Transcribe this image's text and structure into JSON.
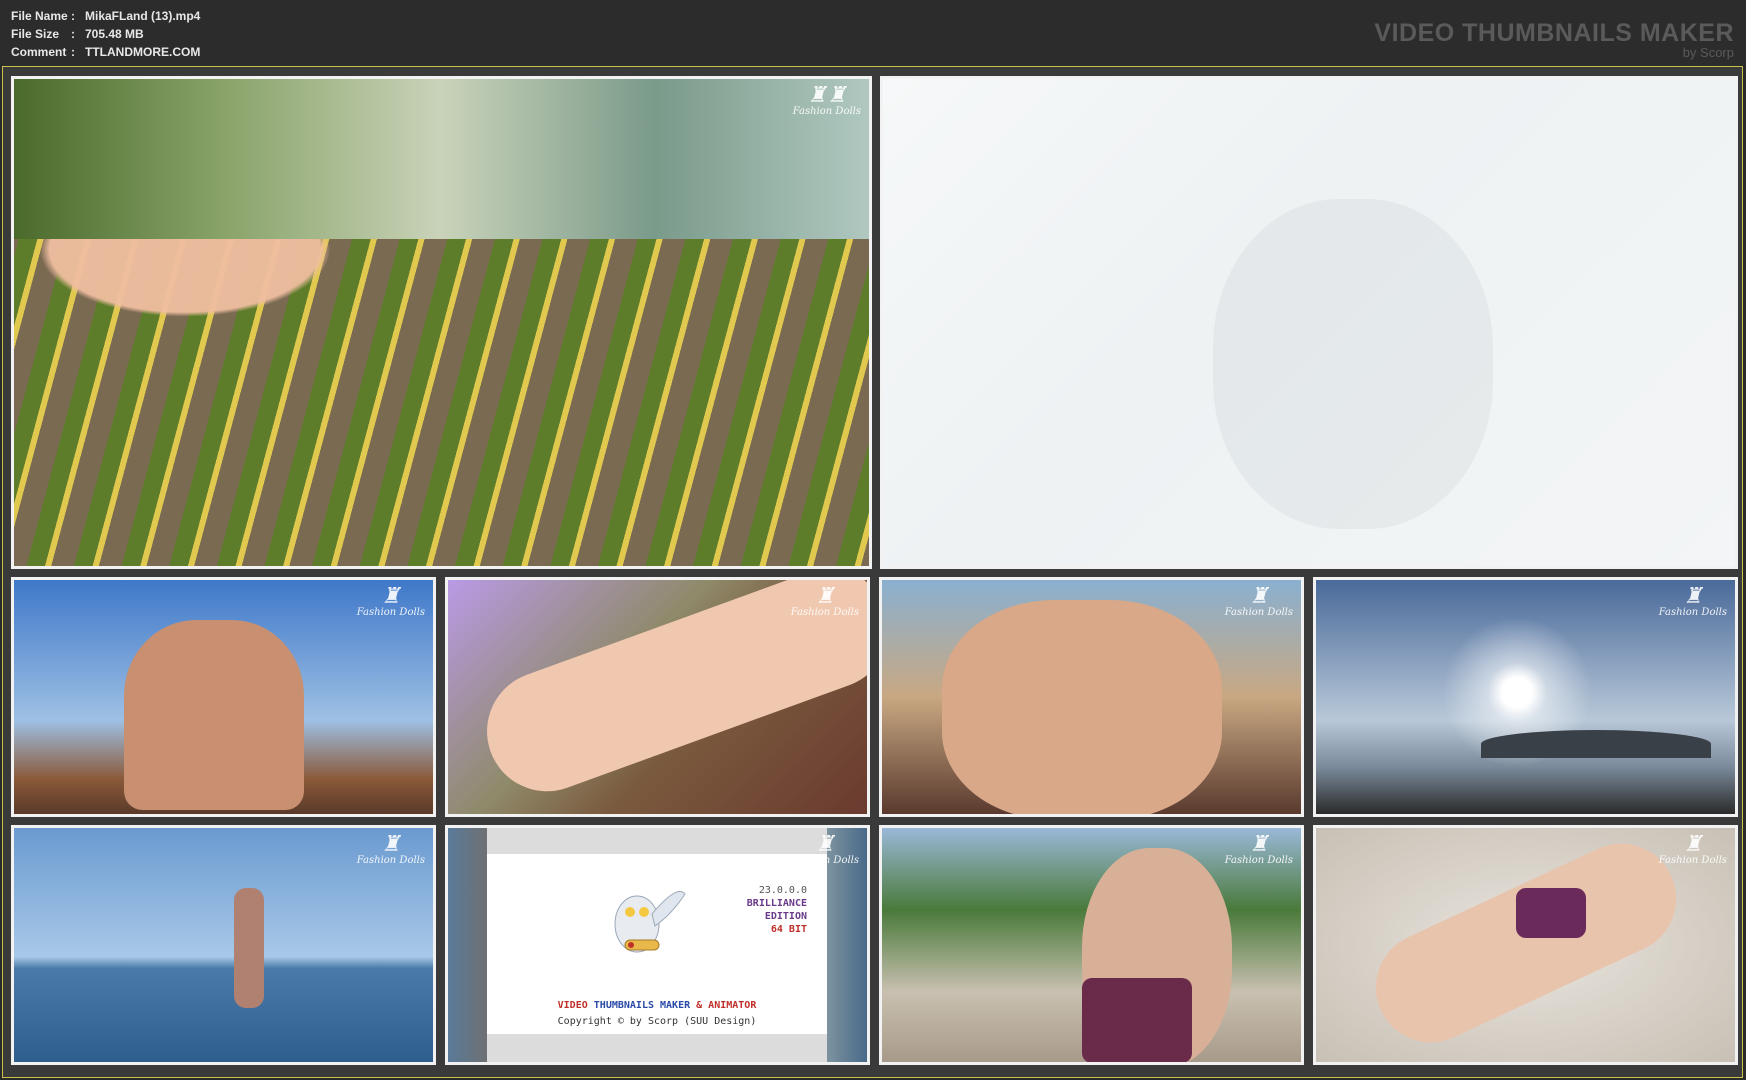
{
  "header": {
    "rows": [
      {
        "key": "File Name",
        "sep": ":",
        "value": "MikaFLand (13).mp4"
      },
      {
        "key": "File Size",
        "sep": ":",
        "value": "705.48 MB"
      },
      {
        "key": "Comment",
        "sep": ":",
        "value": "TTLANDMORE.COM"
      }
    ],
    "brand_title": "VIDEO THUMBNAILS MAKER",
    "brand_sub": "by Scorp"
  },
  "thumbnails": [
    {
      "id": 1,
      "logo": "Fashion Dolls"
    },
    {
      "id": 2,
      "logo": ""
    },
    {
      "id": 3,
      "logo": "Fashion Dolls"
    },
    {
      "id": 4,
      "logo": "Fashion Dolls"
    },
    {
      "id": 5,
      "logo": "Fashion Dolls"
    },
    {
      "id": 6,
      "logo": "Fashion Dolls"
    },
    {
      "id": 7,
      "logo": "Fashion Dolls"
    },
    {
      "id": 8,
      "logo": "Fashion Dolls"
    },
    {
      "id": 9,
      "logo": "Fashion Dolls"
    },
    {
      "id": 10,
      "logo": "Fashion Dolls"
    }
  ],
  "splash": {
    "version": "23.0.0.0",
    "edition_line1": "BRILLIANCE",
    "edition_line2": "EDITION",
    "bits": "64 BIT",
    "title_a": "VIDEO",
    "title_b": "THUMBNAILS MAKER",
    "title_c": "& ANIMATOR",
    "copyright": "Copyright © by Scorp (SUU Design)"
  },
  "colors": {
    "header_bg": "#2c2c2c",
    "sheet_border": "#c9c24a",
    "thumb_border": "#f2f2f2"
  }
}
